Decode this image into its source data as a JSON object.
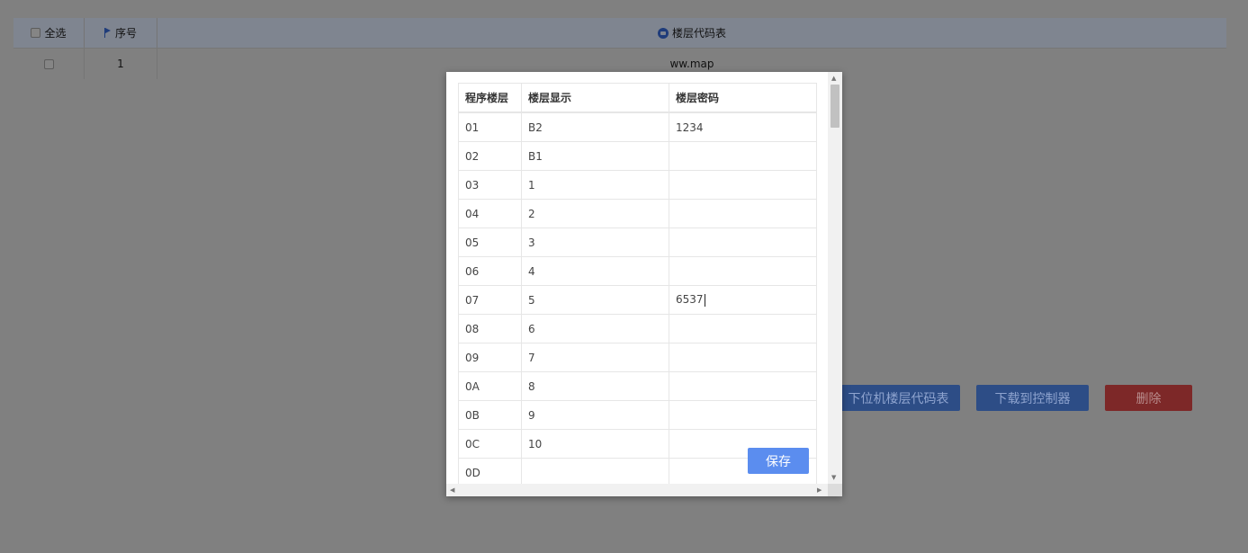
{
  "list": {
    "select_all": "全选",
    "index_header": "序号",
    "table_header": "楼层代码表",
    "rows": [
      {
        "index": "1",
        "file": "ww.map"
      }
    ]
  },
  "actions": {
    "upload_label": "下位机楼层代码表",
    "download_label": "下载到控制器",
    "delete_label": "删除"
  },
  "modal": {
    "columns": [
      "程序楼层",
      "楼层显示",
      "楼层密码"
    ],
    "rows": [
      [
        "01",
        "B2",
        "1234"
      ],
      [
        "02",
        "B1",
        ""
      ],
      [
        "03",
        "1",
        ""
      ],
      [
        "04",
        "2",
        ""
      ],
      [
        "05",
        "3",
        ""
      ],
      [
        "06",
        "4",
        ""
      ],
      [
        "07",
        "5",
        "6537"
      ],
      [
        "08",
        "6",
        ""
      ],
      [
        "09",
        "7",
        ""
      ],
      [
        "0A",
        "8",
        ""
      ],
      [
        "0B",
        "9",
        ""
      ],
      [
        "0C",
        "10",
        ""
      ],
      [
        "0D",
        "",
        ""
      ]
    ],
    "save_label": "保存"
  }
}
